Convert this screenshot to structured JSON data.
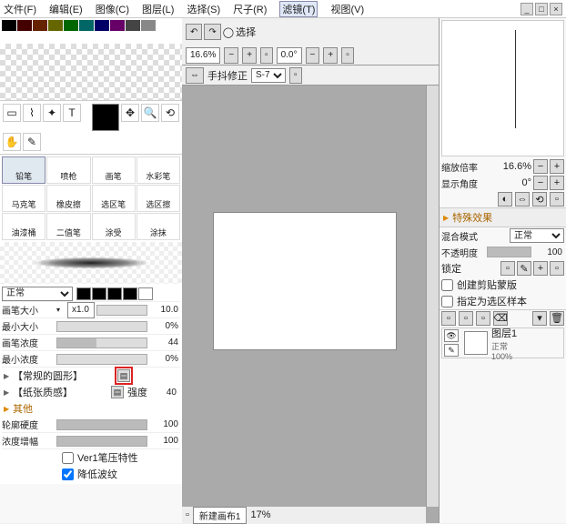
{
  "menu": {
    "file": "文件(F)",
    "edit": "编辑(E)",
    "image": "图像(C)",
    "layer": "图层(L)",
    "select": "选择(S)",
    "ruler": "尺子(R)",
    "filter": "滤镜(T)",
    "view": "视图(V)"
  },
  "top": {
    "undo": "↶",
    "redo": "↷",
    "select_label": "选择",
    "zoom": "16.6%",
    "angle": "0.0°",
    "stabilizer": "手抖修正",
    "stab_val": "S-7"
  },
  "brushes": {
    "b0": "铅笔",
    "b1": "喷枪",
    "b2": "画笔",
    "b3": "水彩笔",
    "b4": "马克笔",
    "b5": "橡皮擦",
    "b6": "选区笔",
    "b7": "选区擦",
    "b8": "油漆桶",
    "b9": "二值笔",
    "b10": "涂受",
    "b11": "涂抹"
  },
  "mode_label": "正常",
  "props": {
    "size_lbl": "画笔大小",
    "size_mult": "x1.0",
    "size_val": "10.0",
    "min_size_lbl": "最小大小",
    "min_size_val": "0%",
    "density_lbl": "画笔浓度",
    "density_val": "44",
    "min_density_lbl": "最小浓度",
    "min_density_val": "0%",
    "shape_lbl": "【常规的圆形】",
    "texture_lbl": "【纸张质感】",
    "tex_strength_lbl": "强度",
    "tex_val": "40",
    "other_lbl": "其他",
    "edge_lbl": "轮廓硬度",
    "edge_val": "100",
    "dens_gain_lbl": "浓度增幅",
    "dens_gain_val": "100",
    "pen_pressure": "Ver1笔压特性",
    "reduce_noise": "降低波纹"
  },
  "doc": {
    "name": "新建画布1",
    "zoom": "17%"
  },
  "right": {
    "zoom_lbl": "缩放倍率",
    "zoom_val": "16.6%",
    "angle_lbl": "显示角度",
    "angle_val": "0°",
    "fx_lbl": "特殊效果",
    "blend_lbl": "混合模式",
    "blend_val": "正常",
    "opacity_lbl": "不透明度",
    "opacity_val": "100",
    "lock_lbl": "锁定",
    "clip_lbl": "创建剪贴蒙版",
    "sel_source_lbl": "指定为选区样本",
    "layer_name": "图层1",
    "layer_mode": "正常",
    "layer_opacity": "100%"
  }
}
